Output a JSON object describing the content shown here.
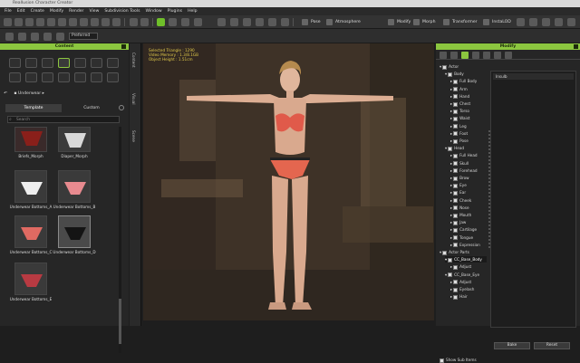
{
  "window": {
    "title": "Reallusion Character Creator"
  },
  "menu": [
    "File",
    "Edit",
    "Create",
    "Modify",
    "Render",
    "View",
    "Subdivision Tools",
    "Window",
    "Plugins",
    "Help"
  ],
  "toolbar": {
    "pose": "Pose",
    "atmosphere": "Atmosphere",
    "modify": "Modify",
    "morph": "Morph",
    "transformer": "Transformer",
    "insight": "InstaLOD",
    "render_mode": "Preferred"
  },
  "content": {
    "header": "Content",
    "path": "Underwear",
    "tabs": [
      "Template",
      "Custom"
    ],
    "search_placeholder": "Search",
    "items": [
      {
        "label": "Briefs_Morph"
      },
      {
        "label": "Diaper_Morph"
      },
      {
        "label": "Underwear Bottoms_A"
      },
      {
        "label": "Underwear Bottoms_B"
      },
      {
        "label": "Underwear Bottoms_C"
      },
      {
        "label": "Underwear Bottoms_D"
      },
      {
        "label": "Underwear Bottoms_E"
      }
    ]
  },
  "side_tabs": [
    "Content",
    "Visual",
    "Scene"
  ],
  "viewport": {
    "hud": [
      "Selected Triangle : 1290",
      "Video Memory : 1.3/8.1GB",
      "Object Height : 1.51cm"
    ]
  },
  "modify": {
    "header": "Modify",
    "tree": [
      {
        "label": "Actor",
        "level": 0
      },
      {
        "label": "Body",
        "level": 1
      },
      {
        "label": "Full Body",
        "level": 2
      },
      {
        "label": "Arm",
        "level": 2
      },
      {
        "label": "Hand",
        "level": 2
      },
      {
        "label": "Chest",
        "level": 2
      },
      {
        "label": "Torso",
        "level": 2
      },
      {
        "label": "Waist",
        "level": 2
      },
      {
        "label": "Leg",
        "level": 2
      },
      {
        "label": "Foot",
        "level": 2
      },
      {
        "label": "Pose",
        "level": 2
      },
      {
        "label": "Head",
        "level": 1
      },
      {
        "label": "Full Head",
        "level": 2
      },
      {
        "label": "Skull",
        "level": 2
      },
      {
        "label": "Forehead",
        "level": 2
      },
      {
        "label": "Brow",
        "level": 2
      },
      {
        "label": "Eye",
        "level": 2
      },
      {
        "label": "Ear",
        "level": 2
      },
      {
        "label": "Cheek",
        "level": 2
      },
      {
        "label": "Nose",
        "level": 2
      },
      {
        "label": "Mouth",
        "level": 2
      },
      {
        "label": "Jaw",
        "level": 2
      },
      {
        "label": "Cartilage",
        "level": 2
      },
      {
        "label": "Tongue",
        "level": 2
      },
      {
        "label": "Expression",
        "level": 2
      },
      {
        "label": "Actor Parts",
        "level": 0
      },
      {
        "label": "CC_Base_Body",
        "level": 1,
        "highlight": true
      },
      {
        "label": "Adjust",
        "level": 2
      },
      {
        "label": "CC_Base_Eye",
        "level": 1
      },
      {
        "label": "Adjust",
        "level": 2
      },
      {
        "label": "Eyelash",
        "level": 2
      },
      {
        "label": "Hair",
        "level": 2
      }
    ],
    "morph_item": "Insulb",
    "bake": "Bake",
    "reset": "Reset",
    "show_sub_items": "Show Sub Items"
  }
}
